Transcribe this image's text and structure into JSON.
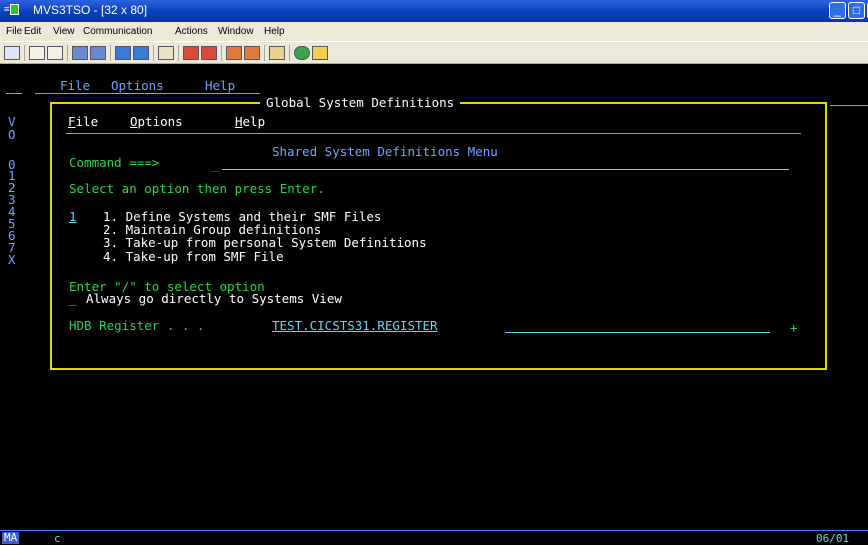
{
  "window": {
    "title": "MVS3TSO - [32 x 80]",
    "controls": [
      "minimize",
      "maximize",
      "close"
    ]
  },
  "menubar": {
    "items": [
      "File",
      "Edit",
      "View",
      "Communication",
      "Actions",
      "Window",
      "Help"
    ]
  },
  "terminal": {
    "outer_menu": [
      "File",
      "Options",
      "Help"
    ],
    "left_column": [
      "V",
      "O",
      "0",
      "1",
      "2",
      "3",
      "4",
      "5",
      "6",
      "7",
      "X"
    ],
    "dialog": {
      "title": "Global System Definitions",
      "menu": [
        "File",
        "Options",
        "Help"
      ],
      "subtitle": "Shared System Definitions Menu",
      "command_label": "Command ===>",
      "command_value": "",
      "instruction": "Select an option then press Enter.",
      "selected_option": "1",
      "options": [
        "1. Define Systems and their SMF Files",
        "2. Maintain Group definitions",
        "3. Take-up from personal System Definitions",
        "4. Take-up from SMF File"
      ],
      "select_prompt": "Enter \"/\" to select option",
      "checkbox_value": "_",
      "checkbox_label": "Always go directly to Systems View",
      "hdb_label": "HDB Register . . .",
      "hdb_value": "TEST.CICSTS31.REGISTER",
      "hdb_more": "+"
    },
    "status": {
      "mode": "MA",
      "session": "c",
      "cursor_pos": "06/01"
    }
  },
  "colors": {
    "title_bar": "#0a3fbc",
    "terminal_bg": "#000000",
    "dialog_border": "#e6d800",
    "green_text": "#26d64b",
    "blue_text": "#6fa4ff",
    "cyan_text": "#5fd9ec"
  }
}
